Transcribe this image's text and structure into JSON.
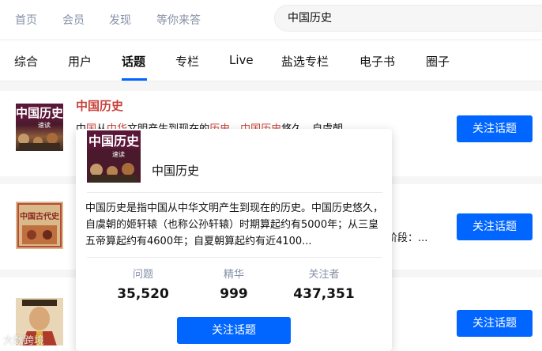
{
  "topnav": [
    "首页",
    "会员",
    "发现",
    "等你来答"
  ],
  "search": {
    "value": "中国历史"
  },
  "tabs": [
    "综合",
    "用户",
    "话题",
    "专栏",
    "Live",
    "盐选专栏",
    "电子书",
    "圈子"
  ],
  "result1": {
    "title": "中国历史",
    "thumb_text_top": "中国历史",
    "thumb_text_sub": "速读",
    "excerpt": {
      "p1": "中",
      "h1": "国",
      "p2": "从",
      "h2": "中华",
      "p3": "文明产生到现在的",
      "h3": "历史",
      "p4": "。",
      "h4": "中国历史",
      "p5": "悠久，自虞朝..."
    },
    "button": "关注话题"
  },
  "result2": {
    "excerpt_tail": "阶段：...",
    "thumb_text": "中国古代史",
    "button": "关注话题"
  },
  "result3": {
    "button": "关注话题"
  },
  "popover": {
    "thumb_text_top": "中国历史",
    "thumb_text_sub": "速读",
    "name": "中国历史",
    "description": "中国历史是指中国从中华文明产生到现在的历史。中国历史悠久，自虞朝的姬轩辕（也称公孙轩辕）时期算起约有5000年；从三皇五帝算起约有4600年；自夏朝算起约有近4100...",
    "stats": [
      {
        "label": "问题",
        "value": "35,520"
      },
      {
        "label": "精华",
        "value": "999"
      },
      {
        "label": "关注者",
        "value": "437,351"
      }
    ],
    "button": "关注话题"
  },
  "watermark": "大数跨境",
  "colors": {
    "accent": "#0066ff",
    "highlight": "#c8413a",
    "muted": "#8590a6"
  }
}
